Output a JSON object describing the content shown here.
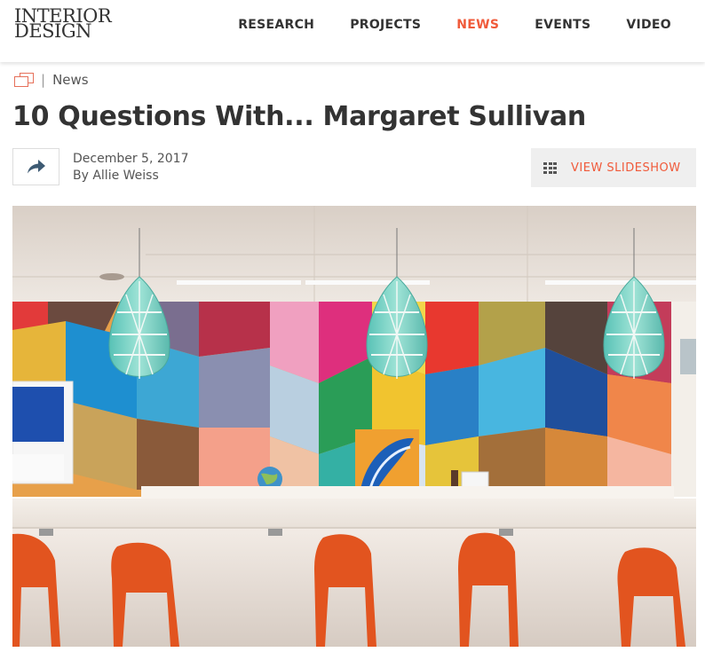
{
  "header": {
    "logo_line1": "INTERIOR",
    "logo_line2": "DESIGN",
    "nav": [
      "RESEARCH",
      "PROJECTS",
      "NEWS",
      "EVENTS",
      "VIDEO"
    ],
    "active_nav": "NEWS"
  },
  "breadcrumb": {
    "separator": "|",
    "section": "News"
  },
  "article": {
    "title": "10 Questions With... Margaret Sullivan",
    "date": "December 5, 2017",
    "byline": "By Allie Weiss",
    "slideshow_label": "VIEW SLIDESHOW"
  },
  "icons": {
    "share": "share-arrow-icon",
    "slideshow": "grid-icon",
    "breadcrumb": "folder-stack-icon"
  },
  "colors": {
    "accent": "#f05a3a",
    "text": "#333333"
  }
}
